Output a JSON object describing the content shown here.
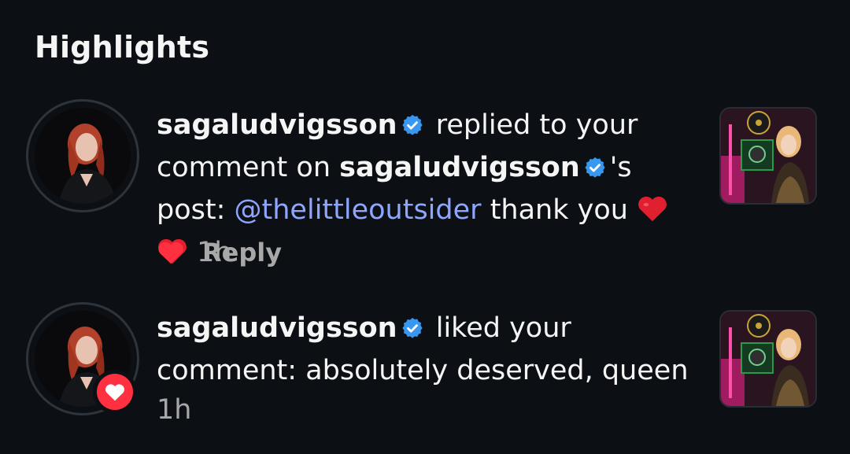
{
  "section": {
    "title": "Highlights"
  },
  "notifications": [
    {
      "username": "sagaludvigsson",
      "action_text": "replied to your comment on",
      "target_user": "sagaludvigsson",
      "target_suffix": "'s post:",
      "mention": "@thelittleoutsider",
      "message": "thank you",
      "time": "1h",
      "reply_label": "Reply",
      "avatar_icon": "profile-photo-red-hair",
      "thumbnail_icon": "post-photo-gold-record"
    },
    {
      "username": "sagaludvigsson",
      "action_text": "liked your comment: absolutely deserved, queen",
      "time": "1h",
      "badge_icon": "heart-icon",
      "avatar_icon": "profile-photo-red-hair",
      "thumbnail_icon": "post-photo-gold-record"
    }
  ],
  "colors": {
    "background": "#0c0f14",
    "text": "#f5f5f5",
    "muted": "#a8a8a8",
    "mention": "#8ea6ff",
    "verified": "#3897f0",
    "heart": "#ff3040"
  }
}
